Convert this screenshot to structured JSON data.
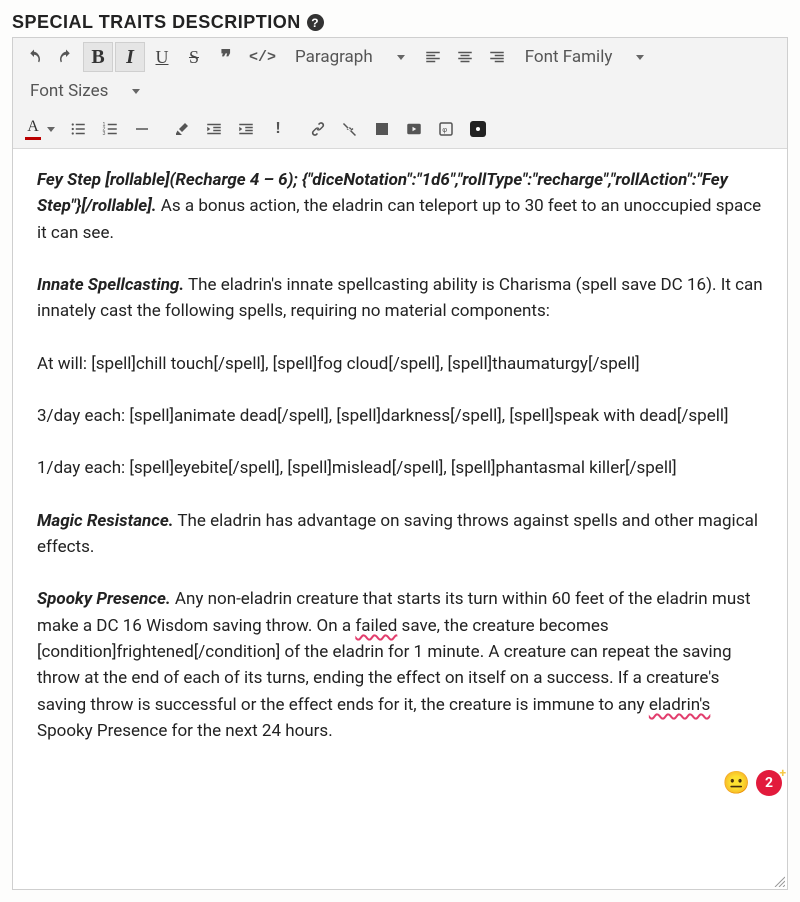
{
  "header": {
    "title": "SPECIAL TRAITS DESCRIPTION"
  },
  "toolbar": {
    "format_dd": "Paragraph",
    "fontfamily_dd": "Font Family",
    "fontsize_dd": "Font Sizes",
    "bold": "B",
    "italic": "I",
    "underline": "U",
    "strike": "S",
    "quote": "❞",
    "code": "</>",
    "textcolor": "A",
    "excl": "!"
  },
  "content": {
    "p1_lead": "Fey Step [rollable](Recharge 4 – 6); {\"diceNotation\":\"1d6\",\"rollType\":\"recharge\",\"rollAction\":\"Fey Step\"}[/rollable].",
    "p1_rest": " As a bonus action, the eladrin can teleport up to 30 feet to an unoccupied space it can see.",
    "p2_lead": "Innate Spellcasting.",
    "p2_rest": " The eladrin's innate spellcasting ability is Charisma (spell save DC 16). It can innately cast the following spells, requiring no material components:",
    "p3": "At will: [spell]chill touch[/spell], [spell]fog cloud[/spell], [spell]thaumaturgy[/spell]",
    "p4": "3/day each: [spell]animate dead[/spell], [spell]darkness[/spell], [spell]speak with dead[/spell]",
    "p5": "1/day each: [spell]eyebite[/spell], [spell]mislead[/spell], [spell]phantasmal killer[/spell]",
    "p6_lead": "Magic Resistance.",
    "p6_rest": " The eladrin has advantage on saving throws against spells and other magical effects.",
    "p7_lead": "Spooky Presence.",
    "p7_a": " Any non-eladrin creature that starts its turn within 60 feet of the eladrin must make a DC 16 Wisdom saving throw. On a ",
    "p7_err1": "failed",
    "p7_b": " save, the creature becomes [condition]frightened[/condition] of the eladrin for 1 minute. A creature can repeat the saving throw at the end of each of its turns, ending the effect on itself on a success. If a creature's saving throw is successful or the effect ends for it, the creature is immune to any ",
    "p7_err2": "eladrin's",
    "p7_c": " Spooky Presence for the next 24 hours."
  },
  "badges": {
    "emoji": "😐",
    "count": "2",
    "plus": "+"
  }
}
